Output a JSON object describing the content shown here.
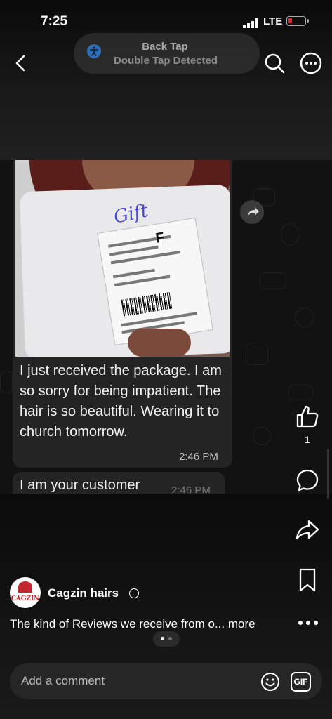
{
  "status_bar": {
    "time": "7:25",
    "network": "LTE"
  },
  "notification": {
    "title": "Back Tap",
    "subtitle": "Double Tap Detected"
  },
  "post_image": {
    "photo_handwriting": "Gift",
    "label_letter": "F",
    "message_text": "I just received the package. I am so sorry for being impatient. The hair is so beautiful. Wearing it to church tomorrow.",
    "message_time": "2:46 PM",
    "message2_text": "I am your customer",
    "message2_time": "2:46 PM"
  },
  "actions": {
    "like_count": "1"
  },
  "post": {
    "avatar_text": "CAGZIN",
    "username": "Cagzin hairs",
    "caption": "The kind of Reviews we receive from o...",
    "more_label": "more"
  },
  "comment": {
    "placeholder": "Add a comment",
    "gif_label": "GIF"
  },
  "colors": {
    "battery_low": "#e3262c",
    "accent_blue": "#2f6fb8",
    "brand_red": "#c0282d"
  }
}
